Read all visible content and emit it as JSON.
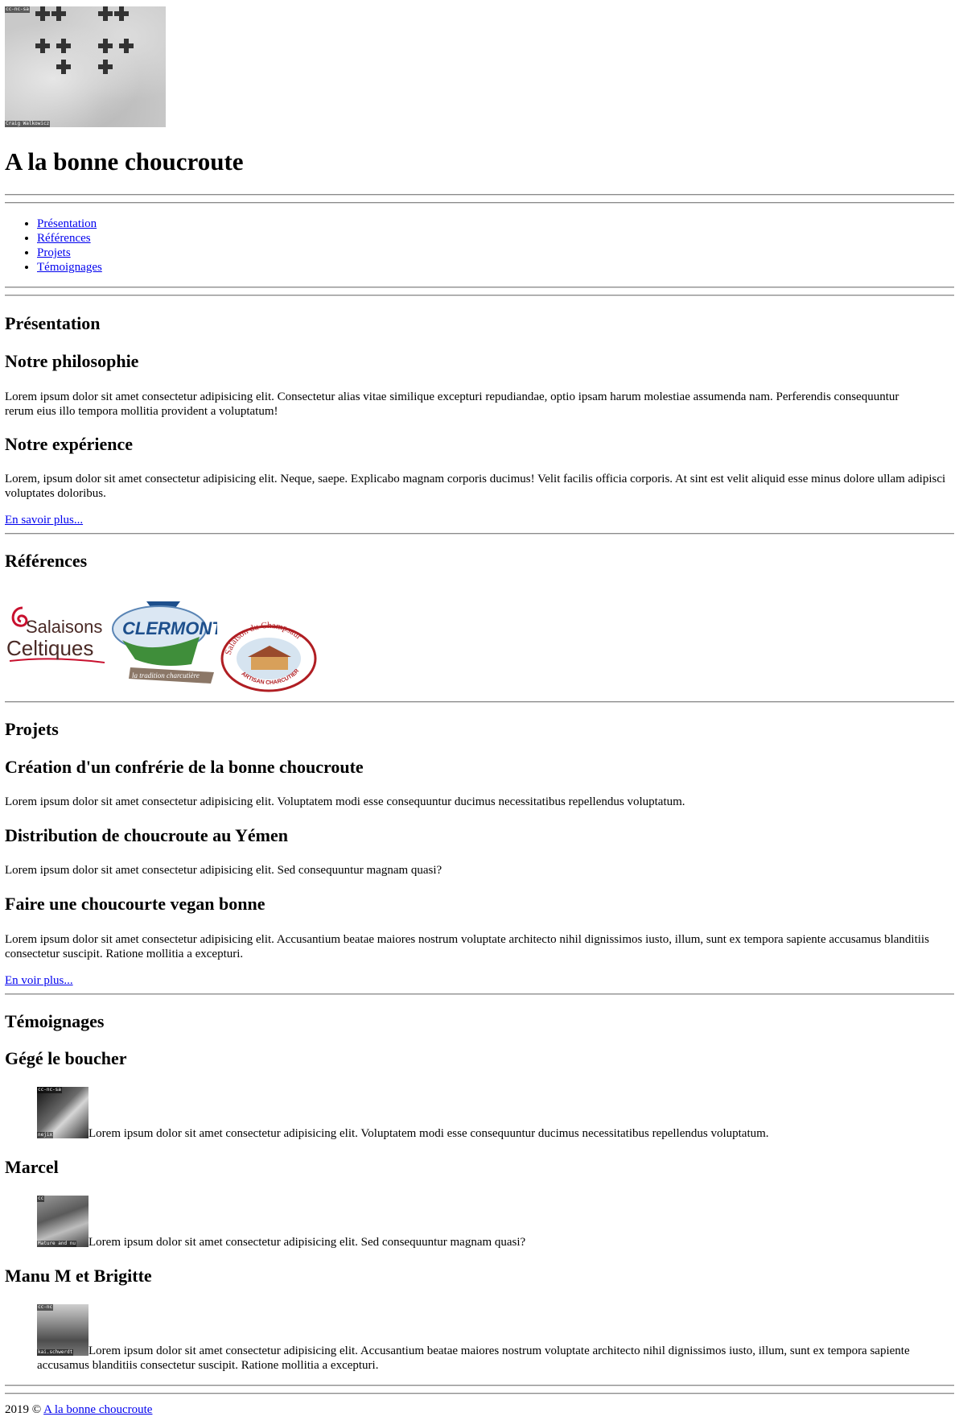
{
  "header": {
    "logo_credit_top": "cc-nc-sa",
    "logo_credit_bottom": "Craig Walkowicz",
    "site_title": "A la bonne choucroute"
  },
  "nav": {
    "items": [
      "Présentation",
      "Références",
      "Projets",
      "Témoignages"
    ]
  },
  "presentation": {
    "heading": "Présentation",
    "philosophy_heading": "Notre philosophie",
    "philosophy_text": "Lorem ipsum dolor sit amet consectetur adipisicing elit. Consectetur alias vitae similique excepturi repudiandae, optio ipsam harum molestiae assumenda nam. Perferendis consequuntur rerum eius illo tempora mollitia provident a voluptatum!",
    "experience_heading": "Notre expérience",
    "experience_text": "Lorem, ipsum dolor sit amet consectetur adipisicing elit. Neque, saepe. Explicabo magnam corporis ducimus! Velit facilis officia corporis. At sint est velit aliquid esse minus dolore ullam adipisci voluptates doloribus.",
    "more_link": "En savoir plus..."
  },
  "references": {
    "heading": "Références",
    "logos": [
      {
        "name": "salaisons-celtiques",
        "line1": "Salaisons",
        "line2": "Celtiques"
      },
      {
        "name": "clermont",
        "line1": "CLERMONT",
        "line2": "la tradition charcutière"
      },
      {
        "name": "salaison-du-champsaur",
        "line1": "Salaison du Champsaur",
        "line2": "ARTISAN CHARCUTIER"
      }
    ]
  },
  "projects": {
    "heading": "Projets",
    "items": [
      {
        "title": "Création d'un confrérie de la bonne choucroute",
        "text": "Lorem ipsum dolor sit amet consectetur adipisicing elit. Voluptatem modi esse consequuntur ducimus necessitatibus repellendus voluptatum."
      },
      {
        "title": "Distribution de choucroute au Yémen",
        "text": "Lorem ipsum dolor sit amet consectetur adipisicing elit. Sed consequuntur magnam quasi?"
      },
      {
        "title": "Faire une choucourte vegan bonne",
        "text": "Lorem ipsum dolor sit amet consectetur adipisicing elit. Accusantium beatae maiores nostrum voluptate architecto nihil dignissimos iusto, illum, sunt ex tempora sapiente accusamus blanditiis consectetur suscipit. Ratione mollitia a excepturi."
      }
    ],
    "more_link": "En voir plus..."
  },
  "testimonials": {
    "heading": "Témoignages",
    "items": [
      {
        "name": "Gégé le boucher",
        "credit_top": "cc-nc-sa",
        "credit_bottom": "nejix",
        "text": "Lorem ipsum dolor sit amet consectetur adipisicing elit. Voluptatem modi esse consequuntur ducimus necessitatibus repellendus voluptatum."
      },
      {
        "name": "Marcel",
        "credit_top": "cc",
        "credit_bottom": "Mature and nu",
        "text": "Lorem ipsum dolor sit amet consectetur adipisicing elit. Sed consequuntur magnam quasi?"
      },
      {
        "name": "Manu M et Brigitte",
        "credit_top": "cc-nc",
        "credit_bottom": "kai.schwerdt",
        "text": "Lorem ipsum dolor sit amet consectetur adipisicing elit. Accusantium beatae maiores nostrum voluptate architecto nihil dignissimos iusto, illum, sunt ex tempora sapiente accusamus blanditiis consectetur suscipit. Ratione mollitia a excepturi."
      }
    ]
  },
  "footer": {
    "year_text": "2019 ©",
    "link": "A la bonne choucroute"
  },
  "colors": {
    "link": "#0000ee",
    "celtiques_red": "#c8102e",
    "clermont_green": "#3f8e3a",
    "clermont_blue": "#1d4f8c",
    "champsaur_red": "#b01e23"
  }
}
